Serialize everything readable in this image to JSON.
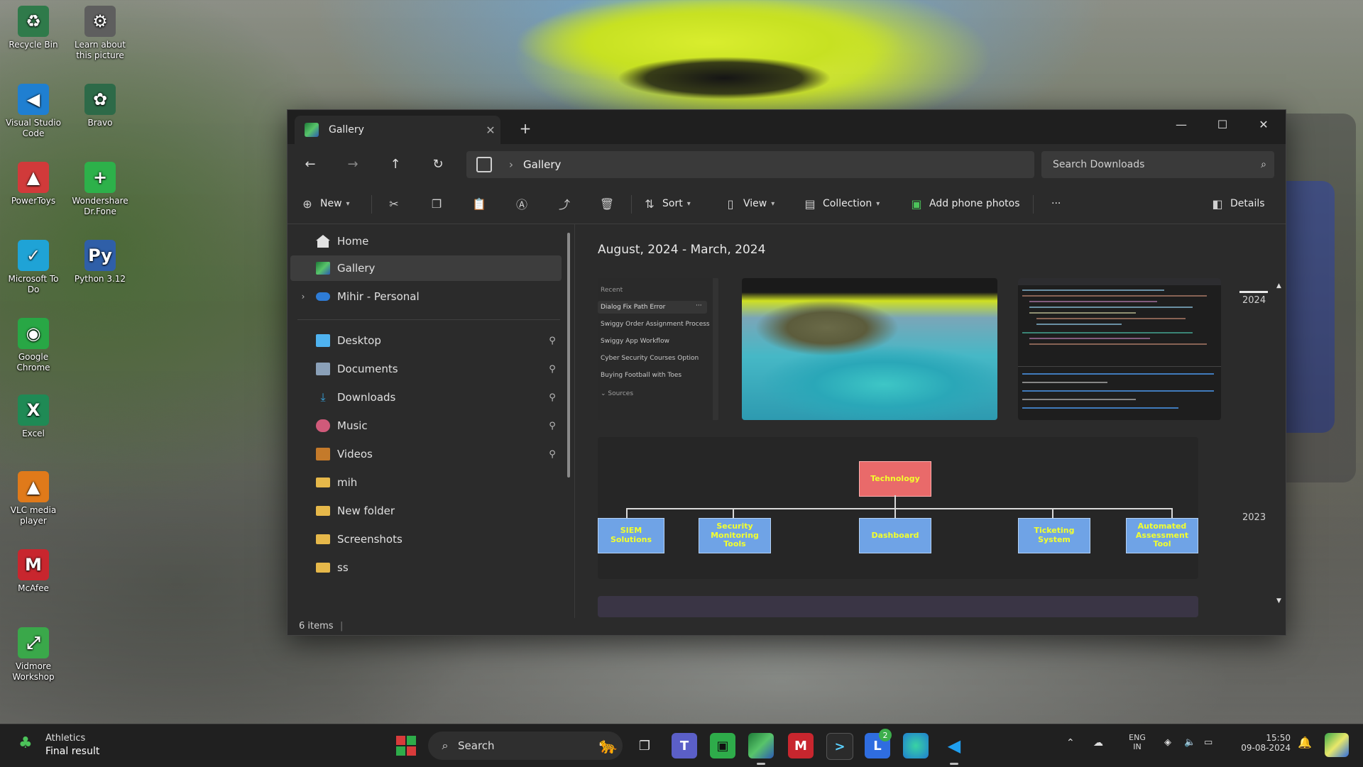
{
  "desktop": {
    "icons": [
      {
        "label": "Recycle Bin",
        "color": "#2f7a4a",
        "glyph": "♻"
      },
      {
        "label": "Learn about this picture",
        "color": "#5e5e5e",
        "glyph": "⚙"
      },
      {
        "label": "Visual Studio Code",
        "color": "#1f7fd1",
        "glyph": "◀"
      },
      {
        "label": "Bravo",
        "color": "#2d6a48",
        "glyph": "✿"
      },
      {
        "label": "PowerToys",
        "color": "#d13a3a",
        "glyph": "▲"
      },
      {
        "label": "Wondershare Dr.Fone",
        "color": "#2db14a",
        "glyph": "+"
      },
      {
        "label": "Microsoft To Do",
        "color": "#1fa3d6",
        "glyph": "✓"
      },
      {
        "label": "Python 3.12",
        "color": "#2f5fa8",
        "glyph": "Py"
      },
      {
        "label": "Google Chrome",
        "color": "#28a745",
        "glyph": "◉"
      },
      {
        "label": "Excel",
        "color": "#1f8a55",
        "glyph": "X"
      },
      {
        "label": "VLC media player",
        "color": "#e07a1a",
        "glyph": "▲"
      },
      {
        "label": "McAfee",
        "color": "#c8262e",
        "glyph": "M"
      },
      {
        "label": "Vidmore Workshop",
        "color": "#3aa84a",
        "glyph": "⤢"
      }
    ]
  },
  "window": {
    "tab_title": "Gallery",
    "tab_close": "✕",
    "new_tab": "+",
    "controls": {
      "minimize": "—",
      "maximize": "☐",
      "close": "✕"
    },
    "nav": {
      "back": "←",
      "forward": "→",
      "up": "↑",
      "refresh": "↻"
    },
    "address": {
      "crumb_sep": "›",
      "location": "Gallery"
    },
    "search": {
      "placeholder": "Search Downloads",
      "icon": "⌕"
    },
    "toolbar": {
      "new_label": "New",
      "sort_label": "Sort",
      "view_label": "View",
      "collection_label": "Collection",
      "add_phone_label": "Add phone photos",
      "more_label": "···",
      "details_label": "Details"
    },
    "sidebar": {
      "items": [
        {
          "label": "Home",
          "color": "#e8e8e8"
        },
        {
          "label": "Gallery",
          "color": "#3ea84e"
        },
        {
          "label": "Mihir - Personal",
          "color": "#2e7cd6"
        },
        {
          "label": "Desktop",
          "color": "#4fb3f0"
        },
        {
          "label": "Documents",
          "color": "#8aa0b8"
        },
        {
          "label": "Downloads",
          "color": "#36a4e0"
        },
        {
          "label": "Music",
          "color": "#d05a7a"
        },
        {
          "label": "Videos",
          "color": "#c47a2a"
        },
        {
          "label": "mih",
          "color": "#e6b84a"
        },
        {
          "label": "New folder",
          "color": "#e6b84a"
        },
        {
          "label": "Screenshots",
          "color": "#e6b84a"
        },
        {
          "label": "ss",
          "color": "#e6b84a"
        }
      ],
      "pin_glyph": "📌"
    },
    "content": {
      "heading": "August, 2024 - March, 2024",
      "chat_panel": {
        "recent_label": "Recent",
        "items": [
          "Dialog Fix Path Error",
          "Swiggy Order Assignment Process",
          "Swiggy App Workflow",
          "Cyber Security Courses Option",
          "Buying Football with Toes"
        ],
        "section_label": "Sources",
        "more": "···"
      },
      "org_chart": {
        "root": "Technology",
        "children": [
          "SIEM Solutions",
          "Security Monitoring Tools",
          "Dashboard",
          "Ticketing System",
          "Automated Assessment Tool"
        ]
      },
      "timeline": {
        "top": "2024",
        "bottom": "2023"
      }
    },
    "status": {
      "items": "6 items"
    }
  },
  "taskbar": {
    "widget": {
      "title": "Athletics",
      "subtitle": "Final result"
    },
    "search_placeholder": "Search",
    "apps": [
      {
        "name": "windows",
        "color": "#d83b3b"
      },
      {
        "name": "task-view",
        "color": "#cccccc"
      },
      {
        "name": "teams",
        "color": "#5b5fc7"
      },
      {
        "name": "app-green",
        "color": "#2eac4a"
      },
      {
        "name": "gallery",
        "color": "#2b8a3e"
      },
      {
        "name": "mcafee",
        "color": "#c8262e"
      },
      {
        "name": "terminal",
        "color": "#3b3b3b"
      },
      {
        "name": "lasso",
        "color": "#2f6de0"
      },
      {
        "name": "edge",
        "color": "#1f9a6a"
      },
      {
        "name": "vscode",
        "color": "#1f7fd1"
      }
    ],
    "badge": "2",
    "tray": {
      "lang_top": "ENG",
      "lang_bottom": "IN",
      "time": "15:50",
      "date": "09-08-2024"
    }
  }
}
